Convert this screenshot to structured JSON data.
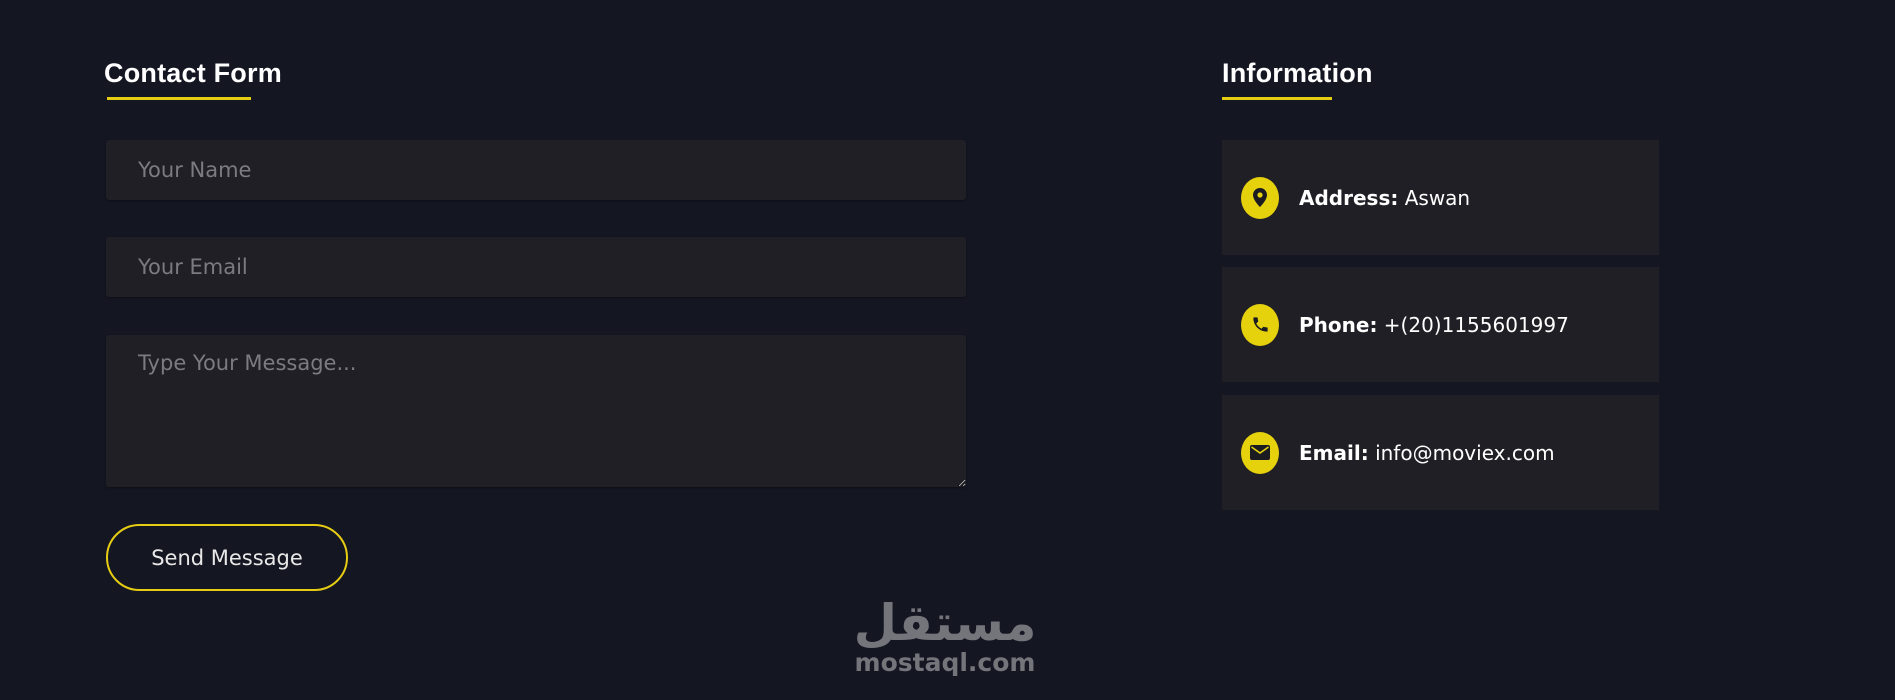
{
  "contact_form": {
    "title": "Contact Form",
    "name_placeholder": "Your Name",
    "email_placeholder": "Your Email",
    "message_placeholder": "Type Your Message...",
    "send_label": "Send Message"
  },
  "information": {
    "title": "Information",
    "items": [
      {
        "icon": "map-marker-icon",
        "label": "Address:",
        "value": "Aswan"
      },
      {
        "icon": "phone-icon",
        "label": "Phone:",
        "value": "+(20)1155601997"
      },
      {
        "icon": "envelope-icon",
        "label": "Email:",
        "value": "info@moviex.com"
      }
    ]
  },
  "watermark": {
    "arabic": "مستقل",
    "latin": "mostaql.com"
  },
  "colors": {
    "background": "#141622",
    "card": "#201f25",
    "accent": "#e6cc12"
  }
}
